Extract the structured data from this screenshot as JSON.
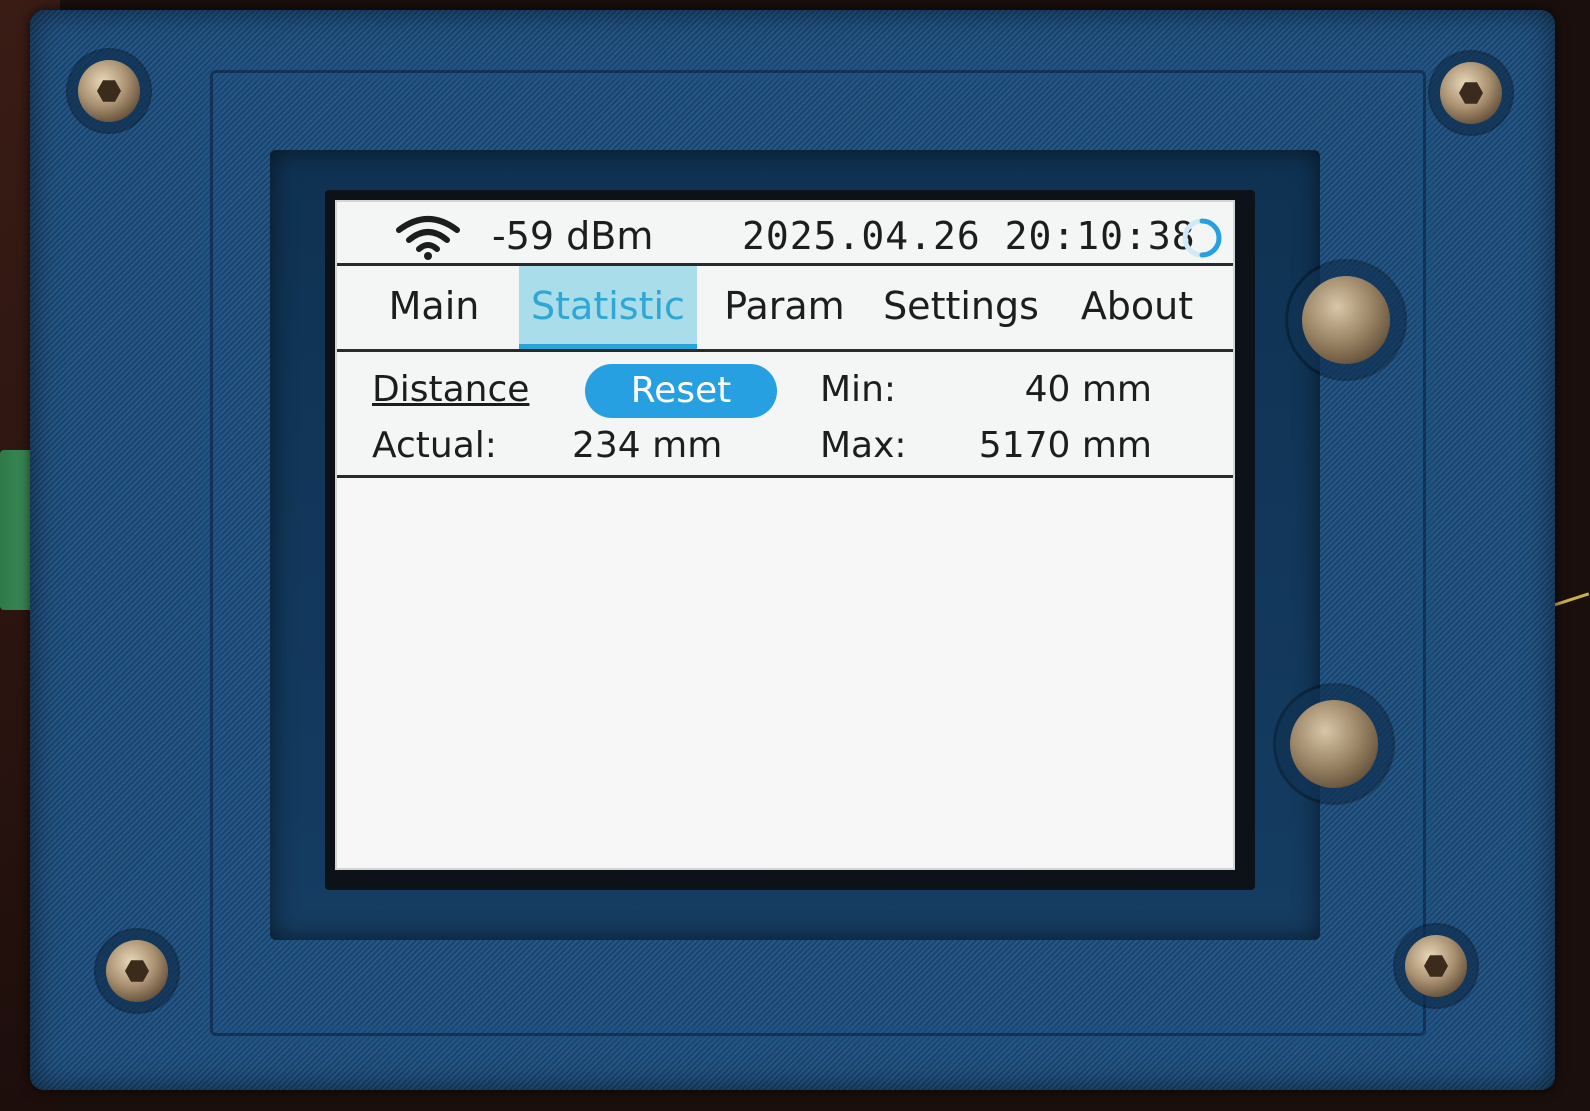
{
  "status": {
    "rssi": "-59 dBm",
    "datetime": "2025.04.26 20:10:38",
    "wifi_icon": "wifi-icon",
    "busy_icon": "spinner-icon"
  },
  "tabs": [
    {
      "label": "Main",
      "active": false
    },
    {
      "label": "Statistic",
      "active": true
    },
    {
      "label": "Param",
      "active": false
    },
    {
      "label": "Settings",
      "active": false
    },
    {
      "label": "About",
      "active": false
    }
  ],
  "stats": {
    "title": "Distance",
    "reset_label": "Reset",
    "min_label": "Min:",
    "min_value": "40 mm",
    "actual_label": "Actual:",
    "actual_value": "234 mm",
    "max_label": "Max:",
    "max_value": "5170 mm"
  },
  "colors": {
    "accent": "#27a0e2",
    "tab_active_bg": "#a9dde9",
    "screen_bg": "#f4f6f5",
    "enclosure": "#1c4f80"
  }
}
